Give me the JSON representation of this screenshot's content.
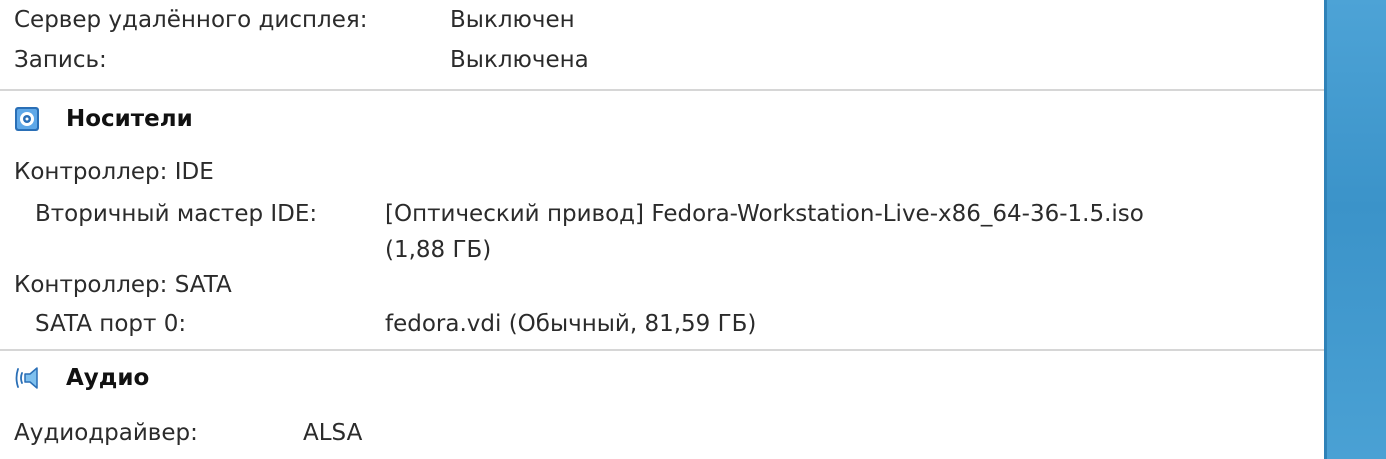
{
  "display": {
    "rows": [
      {
        "label": "Сервер удалённого дисплея:",
        "value": "Выключен"
      },
      {
        "label": "Запись:",
        "value": "Выключена"
      }
    ]
  },
  "storage": {
    "title": "Носители",
    "icon": "storage-disk-icon",
    "controller_ide": "Контроллер: IDE",
    "ide_port_label": "Вторичный мастер IDE:",
    "ide_port_value_line1": "[Оптический привод] Fedora-Workstation-Live-x86_64-36-1.5.iso",
    "ide_port_value_line2": "(1,88 ГБ)",
    "controller_sata": "Контроллер: SATA",
    "sata_port_label": "SATA порт 0:",
    "sata_port_value": "fedora.vdi (Обычный, 81,59 ГБ)"
  },
  "audio": {
    "title": "Аудио",
    "icon": "speaker-icon",
    "driver_label": "Аудиодрайвер:",
    "driver_value": "ALSA"
  },
  "colors": {
    "accent_strip": "#3b93c9",
    "separator": "#d6d6d6"
  }
}
